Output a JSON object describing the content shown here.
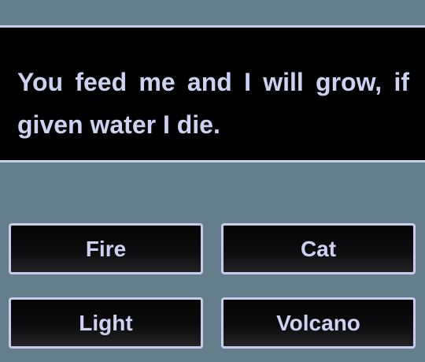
{
  "question": {
    "text": "You feed me and I will grow, if given water I die."
  },
  "answers": [
    {
      "label": "Fire"
    },
    {
      "label": "Cat"
    },
    {
      "label": "Light"
    },
    {
      "label": "Volcano"
    }
  ],
  "colors": {
    "background": "#647e8c",
    "panel": "#000000",
    "border": "#c6ccee",
    "text": "#cdd2f3"
  }
}
